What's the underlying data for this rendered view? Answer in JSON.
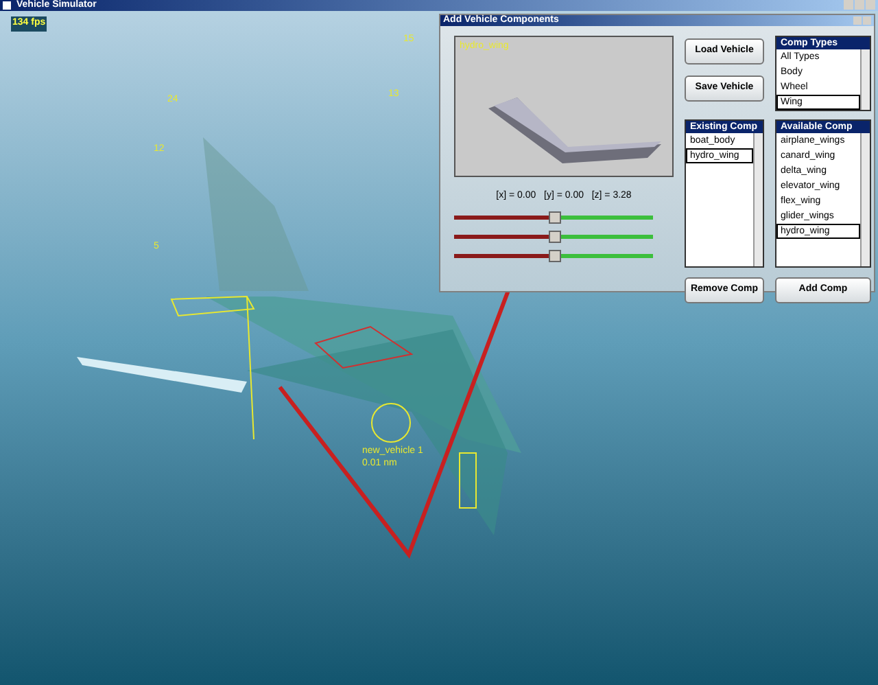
{
  "window": {
    "title": "Vehicle Simulator"
  },
  "scene": {
    "fps": "134 fps",
    "markers": [
      "15",
      "24",
      "12",
      "13",
      "5"
    ],
    "vehicle_label": "new_vehicle 1",
    "distance": "0.01 nm"
  },
  "dialog": {
    "title": "Add Vehicle Components",
    "preview_label": "hydro_wing",
    "coordinates": "[x] = 0.00   [y] = 0.00   [z] = 3.28",
    "sliders": [
      {
        "level": 0.5
      },
      {
        "level": 0.5
      },
      {
        "level": 0.5
      }
    ],
    "buttons": [
      {
        "label": "Load Vehicle"
      },
      {
        "label": "Save Vehicle"
      },
      {
        "label": "Remove Comp"
      },
      {
        "label": "Add Comp"
      }
    ],
    "lists": [
      {
        "title": "Comp Types",
        "items": [
          {
            "label": "All Types",
            "selected": false
          },
          {
            "label": "Body",
            "selected": false
          },
          {
            "label": "Wheel",
            "selected": false
          },
          {
            "label": "Wing",
            "selected": true
          }
        ]
      },
      {
        "title": "Existing Comp",
        "items": [
          {
            "label": "boat_body",
            "selected": false
          },
          {
            "label": "hydro_wing",
            "selected": true
          }
        ]
      },
      {
        "title": "Available Comp",
        "items": [
          {
            "label": "airplane_wings",
            "selected": false
          },
          {
            "label": "canard_wing",
            "selected": false
          },
          {
            "label": "delta_wing",
            "selected": false
          },
          {
            "label": "elevator_wing",
            "selected": false
          },
          {
            "label": "flex_wing",
            "selected": false
          },
          {
            "label": "glider_wings",
            "selected": false
          },
          {
            "label": "hydro_wing",
            "selected": true
          }
        ]
      }
    ]
  }
}
